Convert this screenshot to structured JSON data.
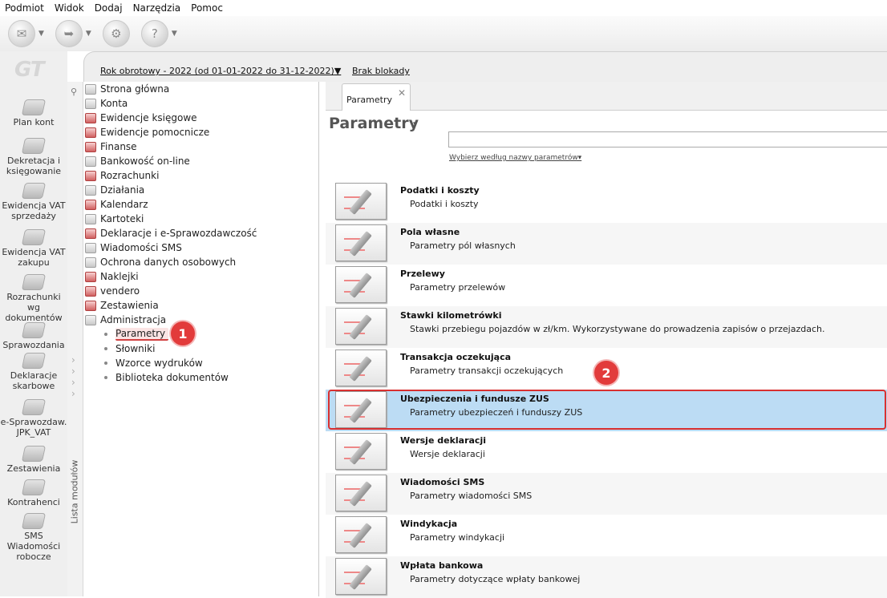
{
  "menu": [
    "Podmiot",
    "Widok",
    "Dodaj",
    "Narzędzia",
    "Pomoc"
  ],
  "toolbar": {
    "buttons": [
      {
        "icon": "envelope-icon",
        "glyph": "✉"
      },
      {
        "icon": "forward-icon",
        "glyph": "➥"
      },
      {
        "icon": "tools-icon",
        "glyph": "⚙"
      },
      {
        "icon": "help-icon",
        "glyph": "?"
      }
    ]
  },
  "logo": "GT",
  "modules": [
    {
      "label": "Plan kont",
      "icon": "plan-kont-icon"
    },
    {
      "label": "Dekretacja i\nksięgowanie",
      "icon": "dekretacja-icon"
    },
    {
      "label": "Ewidencja VAT\nsprzedaży",
      "icon": "vat-sprzedaz-icon"
    },
    {
      "label": "Ewidencja VAT\nzakupu",
      "icon": "vat-zakup-icon"
    },
    {
      "label": "Rozrachunki wg\ndokumentów",
      "icon": "rozrachunki-icon"
    },
    {
      "label": "Sprawozdania",
      "icon": "sprawozdania-icon"
    },
    {
      "label": "Deklaracje\nskarbowe",
      "icon": "deklaracje-icon"
    },
    {
      "label": "e-Sprawozdaw.\nJPK_VAT",
      "icon": "jpk-icon"
    },
    {
      "label": "Zestawienia",
      "icon": "zestawienia-icon"
    },
    {
      "label": "Kontrahenci",
      "icon": "kontrahenci-icon"
    },
    {
      "label": "SMS\nWiadomości\nrobocze",
      "icon": "sms-icon"
    }
  ],
  "context": {
    "fiscal_year": "Rok obrotowy - 2022  (od 01-01-2022 do 31-12-2022)",
    "fiscal_arrow": "▼",
    "lock": "Brak blokady"
  },
  "sidebar_label": "Lista modułów",
  "tree": {
    "items": [
      {
        "label": "Strona główna",
        "red": false
      },
      {
        "label": "Konta",
        "red": false
      },
      {
        "label": "Ewidencje księgowe",
        "red": true
      },
      {
        "label": "Ewidencje pomocnicze",
        "red": true
      },
      {
        "label": "Finanse",
        "red": true
      },
      {
        "label": "Bankowość on-line",
        "red": false
      },
      {
        "label": "Rozrachunki",
        "red": true
      },
      {
        "label": "Działania",
        "red": false
      },
      {
        "label": "Kalendarz",
        "red": true
      },
      {
        "label": "Kartoteki",
        "red": false
      },
      {
        "label": "Deklaracje i e-Sprawozdawczość",
        "red": true
      },
      {
        "label": "Wiadomości SMS",
        "red": false
      },
      {
        "label": "Ochrona danych osobowych",
        "red": false
      },
      {
        "label": "Naklejki",
        "red": true
      },
      {
        "label": "vendero",
        "red": true
      },
      {
        "label": "Zestawienia",
        "red": true
      },
      {
        "label": "Administracja",
        "red": false
      }
    ],
    "sub_items": [
      "Parametry",
      "Słowniki",
      "Wzorce wydruków",
      "Biblioteka dokumentów"
    ]
  },
  "badges": [
    "1",
    "2"
  ],
  "tab": {
    "label": "Parametry",
    "close": "✕"
  },
  "page_title": "Parametry",
  "title_arrow": "▾",
  "search": {
    "value": "",
    "hint": "Wybierz według nazwy parametrów▾"
  },
  "params": [
    {
      "title": "Podatki i koszty",
      "desc": "Podatki i koszty",
      "selected": false
    },
    {
      "title": "Pola własne",
      "desc": "Parametry pól własnych",
      "selected": false
    },
    {
      "title": "Przelewy",
      "desc": "Parametry przelewów",
      "selected": false
    },
    {
      "title": "Stawki kilometrówki",
      "desc": "Stawki przebiegu pojazdów w zł/km. Wykorzystywane do prowadzenia zapisów o przejazdach.",
      "selected": false
    },
    {
      "title": "Transakcja oczekująca",
      "desc": "Parametry transakcji oczekujących",
      "selected": false
    },
    {
      "title": "Ubezpieczenia i fundusze ZUS",
      "desc": "Parametry ubezpieczeń i funduszy ZUS",
      "selected": true
    },
    {
      "title": "Wersje deklaracji",
      "desc": "Wersje deklaracji",
      "selected": false
    },
    {
      "title": "Wiadomości SMS",
      "desc": "Parametry wiadomości SMS",
      "selected": false
    },
    {
      "title": "Windykacja",
      "desc": "Parametry windykacji",
      "selected": false
    },
    {
      "title": "Wpłata bankowa",
      "desc": "Parametry dotyczące wpłaty bankowej",
      "selected": false
    }
  ]
}
